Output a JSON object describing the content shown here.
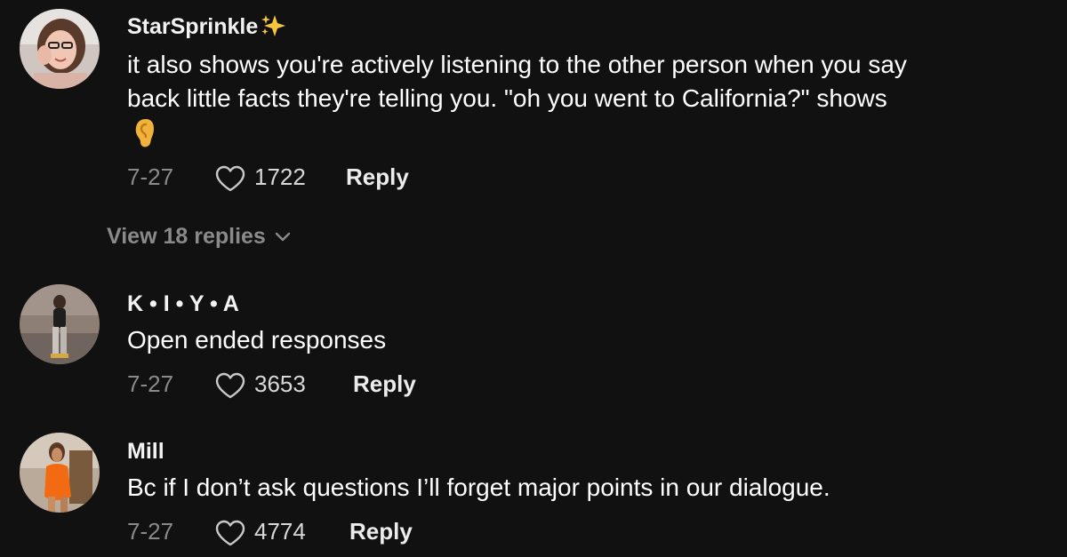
{
  "comments": [
    {
      "username": "StarSprinkle",
      "text_line1": "it also shows you're actively listening to the other person when you say",
      "text_line2": "back little facts they're telling you. \"oh you went to California?\" shows",
      "emoji": "👂",
      "date": "7-27",
      "likes": "1722",
      "reply_label": "Reply",
      "view_replies": "View 18 replies"
    },
    {
      "username": "K • I • Y • A",
      "text": "Open ended responses",
      "date": "7-27",
      "likes": "3653",
      "reply_label": "Reply"
    },
    {
      "username": "Mill",
      "text": "Bc if I don’t ask questions I’ll forget major points in our dialogue.",
      "date": "7-27",
      "likes": "4774",
      "reply_label": "Reply"
    }
  ],
  "colors": {
    "background": "#111111",
    "primary_text": "#ffffff",
    "secondary_text": "#8a8a8a",
    "sparkle": "#f5c542"
  },
  "icons": [
    "sparkle-icon",
    "heart-icon",
    "chevron-down-icon",
    "ear-emoji"
  ]
}
